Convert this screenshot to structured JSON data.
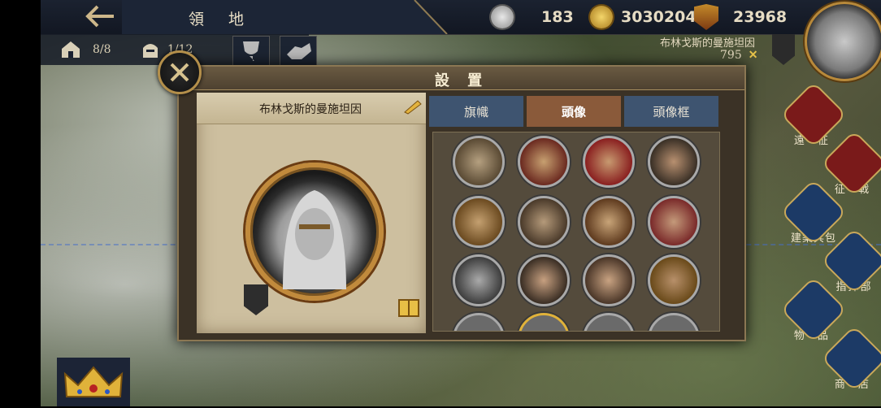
{
  "header": {
    "back_icon": "back-arrow-icon",
    "title": "領 地"
  },
  "resources": [
    {
      "name": "silver-coin-icon",
      "value": "183"
    },
    {
      "name": "gold-coin-icon",
      "value": "3030204"
    },
    {
      "name": "crest-icon",
      "value": "23968"
    }
  ],
  "subbar": {
    "buildings": "8/8",
    "knights": "1/12"
  },
  "player": {
    "name": "布林戈斯的曼施坦因",
    "score": "795"
  },
  "side_menu": [
    {
      "label": "遠 征",
      "icon": "expedition-icon"
    },
    {
      "label": "征 戰",
      "icon": "war-icon"
    },
    {
      "label": "建築兵包",
      "icon": "castle-icon"
    },
    {
      "label": "指揮部",
      "icon": "headquarters-icon"
    },
    {
      "label": "物 品",
      "icon": "chest-icon"
    },
    {
      "label": "商 店",
      "icon": "scales-icon"
    }
  ],
  "dialog": {
    "title": "設 置",
    "player_name": "布林戈斯的曼施坦因",
    "tabs": [
      {
        "label": "旗幟",
        "active": false
      },
      {
        "label": "頭像",
        "active": true
      },
      {
        "label": "頭像框",
        "active": false
      }
    ]
  },
  "colors": {
    "tab_inactive": "#3e5470",
    "tab_active": "#8a5a3a",
    "frame_gold": "#c18a3c"
  }
}
